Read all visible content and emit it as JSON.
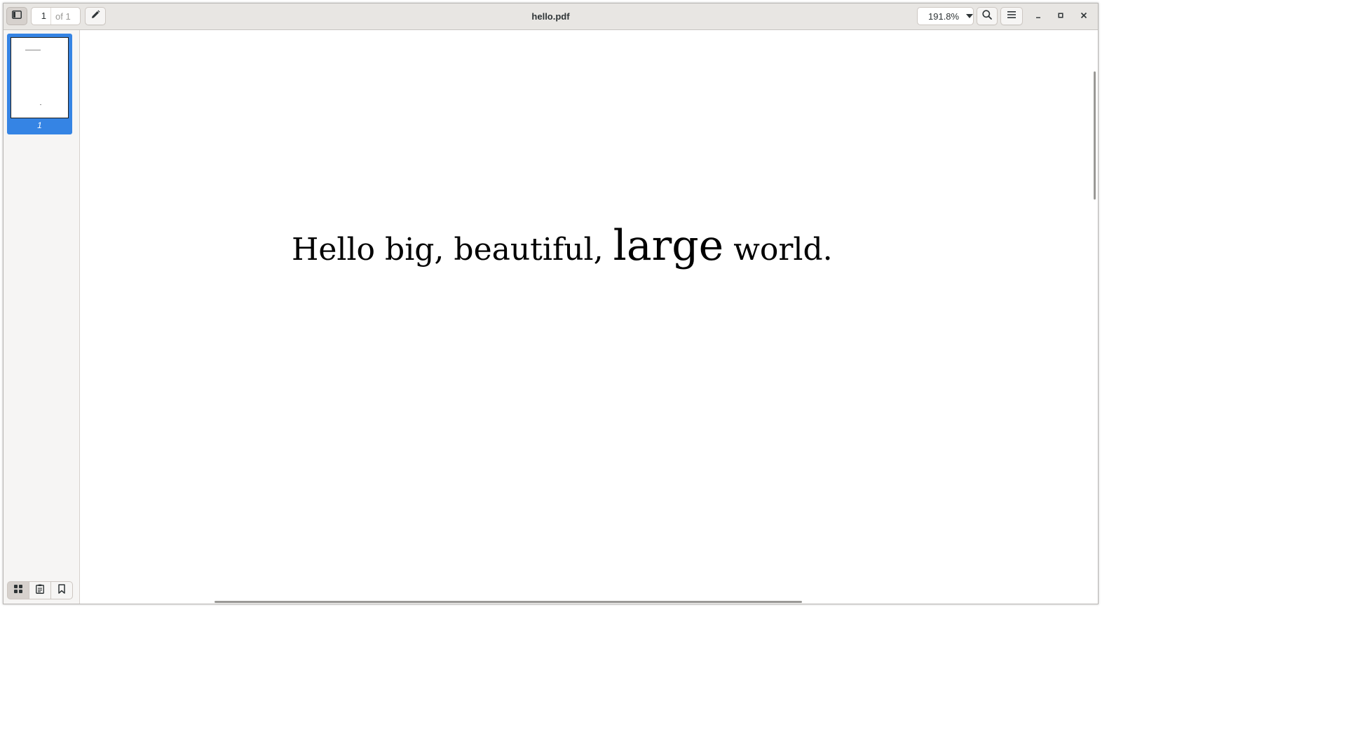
{
  "window": {
    "title": "hello.pdf"
  },
  "toolbar": {
    "sidebar_toggle_icon": "sidebar-icon",
    "page_current": "1",
    "page_of": "of 1",
    "annotate_icon": "pencil-icon",
    "zoom_value": "191.8%",
    "search_icon": "search-icon",
    "menu_icon": "hamburger-menu-icon"
  },
  "window_controls": {
    "minimize_icon": "minimize-icon",
    "maximize_icon": "maximize-icon",
    "close_icon": "close-icon"
  },
  "sidebar": {
    "thumbnails": [
      {
        "label": "1",
        "selected": true
      }
    ],
    "switcher": [
      {
        "name": "thumbnails",
        "icon": "grid-icon",
        "active": true
      },
      {
        "name": "annotations",
        "icon": "clipboard-icon",
        "active": false
      },
      {
        "name": "bookmarks",
        "icon": "bookmark-icon",
        "active": false
      }
    ]
  },
  "document": {
    "text_before": "Hello big, beautiful,",
    "text_large": "large",
    "text_after": "world."
  },
  "colors": {
    "accent": "#3584e4",
    "headerbar": "#e8e6e3",
    "sidebar": "#f6f5f4"
  }
}
